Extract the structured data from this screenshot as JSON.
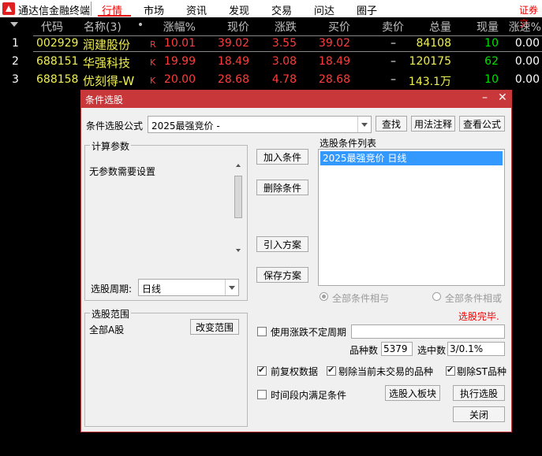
{
  "app": {
    "name": "通达信金融终端",
    "trade_label": "证券交"
  },
  "nav": {
    "tabs": [
      "行情",
      "市场",
      "资讯",
      "发现",
      "交易",
      "问达",
      "圈子"
    ],
    "active": 0
  },
  "table": {
    "headers": [
      "代码",
      "名称(3)",
      "•",
      "涨幅%",
      "现价",
      "涨跌",
      "买价",
      "卖价",
      "总量",
      "现量",
      "涨速%"
    ],
    "rows": [
      {
        "idx": "1",
        "code": "002929",
        "name": "润建股份",
        "flag": "R",
        "pct": "10.01",
        "price": "39.02",
        "chg": "3.55",
        "bid": "39.02",
        "ask": "–",
        "vol": "84108",
        "cur": "10",
        "speed": "0.00"
      },
      {
        "idx": "2",
        "code": "688151",
        "name": "华强科技",
        "flag": "K",
        "pct": "19.99",
        "price": "18.49",
        "chg": "3.08",
        "bid": "18.49",
        "ask": "–",
        "vol": "120175",
        "cur": "62",
        "speed": "0.00"
      },
      {
        "idx": "3",
        "code": "688158",
        "name": "优刻得-W",
        "flag": "K",
        "pct": "20.00",
        "price": "28.68",
        "chg": "4.78",
        "bid": "28.68",
        "ask": "–",
        "vol": "143.1万",
        "cur": "10",
        "speed": "0.00"
      }
    ]
  },
  "dialog": {
    "title": "条件选股",
    "formula_label": "条件选股公式",
    "formula_value": "2025最强竞价 -",
    "btn_find": "查找",
    "btn_usage": "用法注释",
    "btn_view": "查看公式",
    "params_group": "计算参数",
    "params_text": "无参数需要设置",
    "period_label": "选股周期:",
    "period_value": "日线",
    "btn_add": "加入条件",
    "btn_delete": "删除条件",
    "btn_import": "引入方案",
    "btn_save": "保存方案",
    "list_label": "选股条件列表",
    "list_items": [
      "2025最强竞价  日线"
    ],
    "radio_and": "全部条件相与",
    "radio_or": "全部条件相或",
    "status": "选股完毕.",
    "scope_group": "选股范围",
    "scope_value": "全部A股",
    "btn_scope": "改变范围",
    "chk_period": "使用涨跌不定周期",
    "count_label": "品种数",
    "count_value": "5379",
    "selected_label": "选中数",
    "selected_value": "3/0.1%",
    "chk_adjust": "前复权数据",
    "chk_exclude_untraded": "剔除当前未交易的品种",
    "chk_exclude_st": "剔除ST品种",
    "chk_time": "时间段内满足条件",
    "btn_to_block": "选股入板块",
    "btn_run": "执行选股",
    "btn_close": "关闭"
  },
  "colors": {
    "accent": "#c8373a",
    "up": "#ff3c3c",
    "code": "#f0f050",
    "volume": "#00e000"
  }
}
